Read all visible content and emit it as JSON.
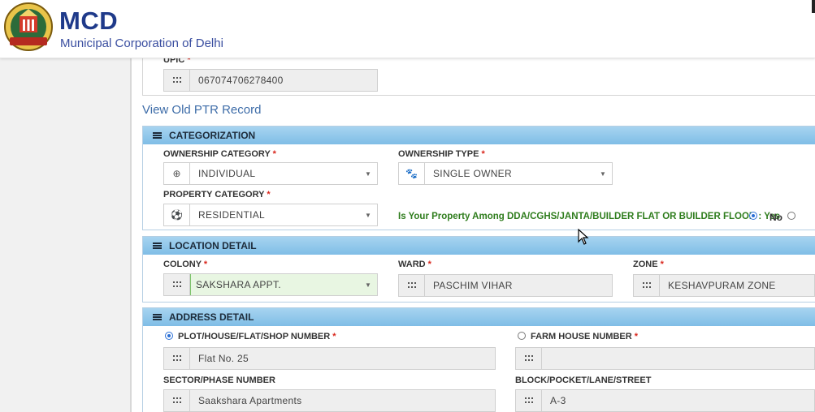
{
  "header": {
    "title": "MCD",
    "subtitle": "Municipal Corporation of Delhi"
  },
  "upic": {
    "label": "UPIC",
    "value": "067074706278400"
  },
  "view_old_ptr": "View Old PTR Record",
  "categorization": {
    "heading": "CATEGORIZATION",
    "ownership_category_label": "OWNERSHIP CATEGORY",
    "ownership_category_value": "INDIVIDUAL",
    "ownership_type_label": "OWNERSHIP TYPE",
    "ownership_type_value": "SINGLE OWNER",
    "property_category_label": "PROPERTY CATEGORY",
    "property_category_value": "RESIDENTIAL",
    "question": "Is Your Property Among DDA/CGHS/JANTA/BUILDER FLAT OR BUILDER FLOOR : Yes",
    "no_label": "No",
    "selected": "Yes"
  },
  "location": {
    "heading": "LOCATION DETAIL",
    "colony_label": "COLONY",
    "colony_value": "SAKSHARA APPT.",
    "ward_label": "WARD",
    "ward_value": "PASCHIM VIHAR",
    "zone_label": "ZONE",
    "zone_value": "KESHAVPURAM ZONE"
  },
  "address": {
    "heading": "ADDRESS DETAIL",
    "plot_label": "PLOT/HOUSE/FLAT/SHOP NUMBER",
    "plot_value": "Flat No. 25",
    "farm_label": "FARM HOUSE NUMBER",
    "farm_value": "",
    "sector_label": "SECTOR/PHASE NUMBER",
    "sector_value": "Saakshara Apartments",
    "block_label": "BLOCK/POCKET/LANE/STREET",
    "block_value": "A-3",
    "selected_option": "PLOT/HOUSE/FLAT/SHOP NUMBER"
  },
  "required_marker": "*",
  "colors": {
    "brand": "#1f3a8a",
    "panel_header": "#8cc6ea",
    "question_text": "#2f7d1d",
    "required": "#d9261c"
  }
}
